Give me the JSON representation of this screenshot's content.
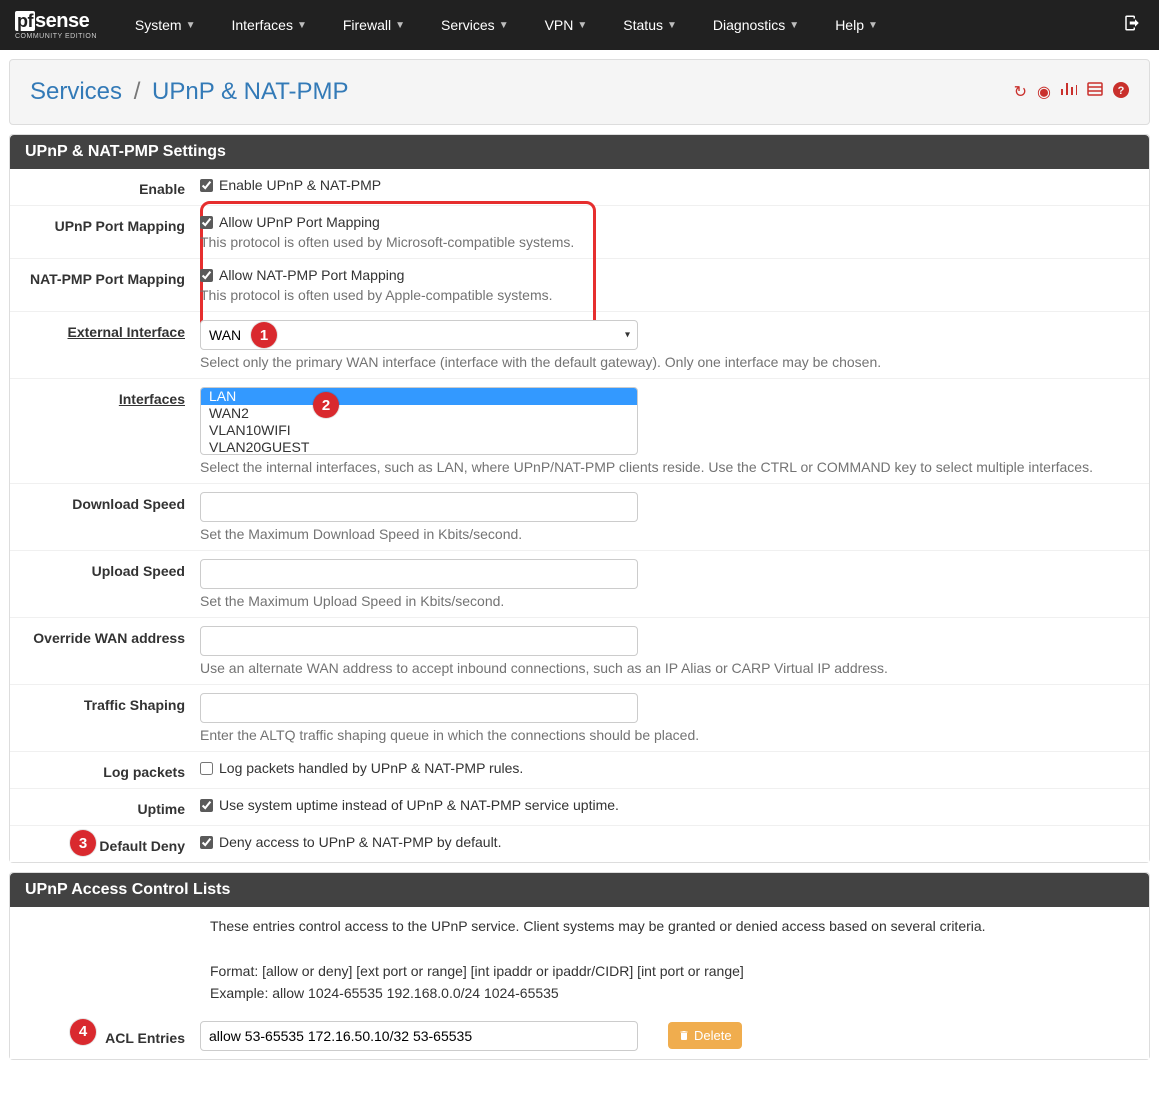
{
  "nav": {
    "logo_pf": "pf",
    "logo_sense": "sense",
    "logo_sub": "COMMUNITY EDITION",
    "items": [
      "System",
      "Interfaces",
      "Firewall",
      "Services",
      "VPN",
      "Status",
      "Diagnostics",
      "Help"
    ]
  },
  "breadcrumb": {
    "parent": "Services",
    "current": "UPnP & NAT-PMP"
  },
  "panel1_title": "UPnP & NAT-PMP Settings",
  "panel2_title": "UPnP Access Control Lists",
  "fields": {
    "enable": {
      "label": "Enable",
      "cb": "Enable UPnP & NAT-PMP"
    },
    "upnp_pm": {
      "label": "UPnP Port Mapping",
      "cb": "Allow UPnP Port Mapping",
      "help": "This protocol is often used by Microsoft-compatible systems."
    },
    "natpmp_pm": {
      "label": "NAT-PMP Port Mapping",
      "cb": "Allow NAT-PMP Port Mapping",
      "help": "This protocol is often used by Apple-compatible systems."
    },
    "ext_iface": {
      "label": "External Interface",
      "value": "WAN",
      "help": "Select only the primary WAN interface (interface with the default gateway). Only one interface may be chosen."
    },
    "interfaces": {
      "label": "Interfaces",
      "options": [
        "LAN",
        "WAN2",
        "VLAN10WIFI",
        "VLAN20GUEST"
      ],
      "selected": "LAN",
      "help": "Select the internal interfaces, such as LAN, where UPnP/NAT-PMP clients reside. Use the CTRL or COMMAND key to select multiple interfaces."
    },
    "dl_speed": {
      "label": "Download Speed",
      "help": "Set the Maximum Download Speed in Kbits/second."
    },
    "ul_speed": {
      "label": "Upload Speed",
      "help": "Set the Maximum Upload Speed in Kbits/second."
    },
    "override_wan": {
      "label": "Override WAN address",
      "help": "Use an alternate WAN address to accept inbound connections, such as an IP Alias or CARP Virtual IP address."
    },
    "traffic_shaping": {
      "label": "Traffic Shaping",
      "help": "Enter the ALTQ traffic shaping queue in which the connections should be placed."
    },
    "log_packets": {
      "label": "Log packets",
      "cb": "Log packets handled by UPnP & NAT-PMP rules."
    },
    "uptime": {
      "label": "Uptime",
      "cb": "Use system uptime instead of UPnP & NAT-PMP service uptime."
    },
    "default_deny": {
      "label": "Default Deny",
      "cb": "Deny access to UPnP & NAT-PMP by default."
    }
  },
  "acl": {
    "intro": "These entries control access to the UPnP service. Client systems may be granted or denied access based on several criteria.",
    "format": "Format: [allow or deny] [ext port or range] [int ipaddr or ipaddr/CIDR] [int port or range]",
    "example": "Example: allow 1024-65535 192.168.0.0/24 1024-65535",
    "entries_label": "ACL Entries",
    "entry_value": "allow 53-65535 172.16.50.10/32 53-65535",
    "delete": "Delete"
  },
  "badges": {
    "b1": "1",
    "b2": "2",
    "b3": "3",
    "b4": "4"
  }
}
